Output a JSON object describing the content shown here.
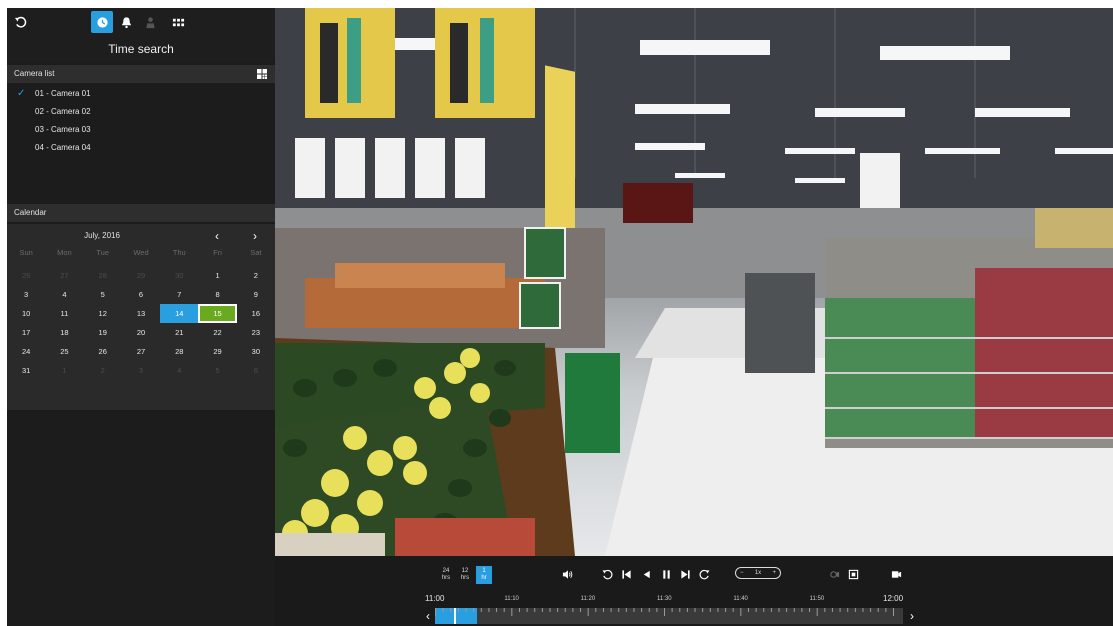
{
  "sidebar": {
    "title": "Time search",
    "camera_list_header": "Camera list",
    "cameras": [
      {
        "label": "01 - Camera 01",
        "checked": true
      },
      {
        "label": "02 - Camera 02",
        "checked": false
      },
      {
        "label": "03 - Camera 03",
        "checked": false
      },
      {
        "label": "04 - Camera 04",
        "checked": false
      }
    ],
    "calendar_header": "Calendar",
    "calendar": {
      "month": "July, 2016",
      "prev": "‹",
      "next": "›",
      "weekdays": [
        "Sun",
        "Mon",
        "Tue",
        "Wed",
        "Thu",
        "Fri",
        "Sat"
      ],
      "weeks": [
        [
          "26",
          "27",
          "28",
          "29",
          "30",
          "1",
          "2"
        ],
        [
          "3",
          "4",
          "5",
          "6",
          "7",
          "8",
          "9"
        ],
        [
          "10",
          "11",
          "12",
          "13",
          "14",
          "15",
          "16"
        ],
        [
          "17",
          "18",
          "19",
          "20",
          "21",
          "22",
          "23"
        ],
        [
          "24",
          "25",
          "26",
          "27",
          "28",
          "29",
          "30"
        ],
        [
          "31",
          "1",
          "2",
          "3",
          "4",
          "5",
          "6"
        ]
      ],
      "selected_day": "14",
      "highlighted_day": "15"
    }
  },
  "controls": {
    "zoom": [
      {
        "top": "24",
        "bottom": "hrs"
      },
      {
        "top": "12",
        "bottom": "hrs"
      },
      {
        "top": "1",
        "bottom": "hr"
      }
    ],
    "speed": {
      "minus": "−",
      "value": "1x",
      "plus": "+"
    },
    "time_labels": [
      "11:00",
      "11:10",
      "11:20",
      "11:30",
      "11:40",
      "11:50",
      "12:00"
    ],
    "timeline_prev": "‹",
    "timeline_next": "›",
    "timeline_range_fraction": 0.09,
    "timeline_cursor_fraction": 0.04
  },
  "colors": {
    "accent": "#2a9fe0",
    "highlight": "#6aaa1e"
  }
}
